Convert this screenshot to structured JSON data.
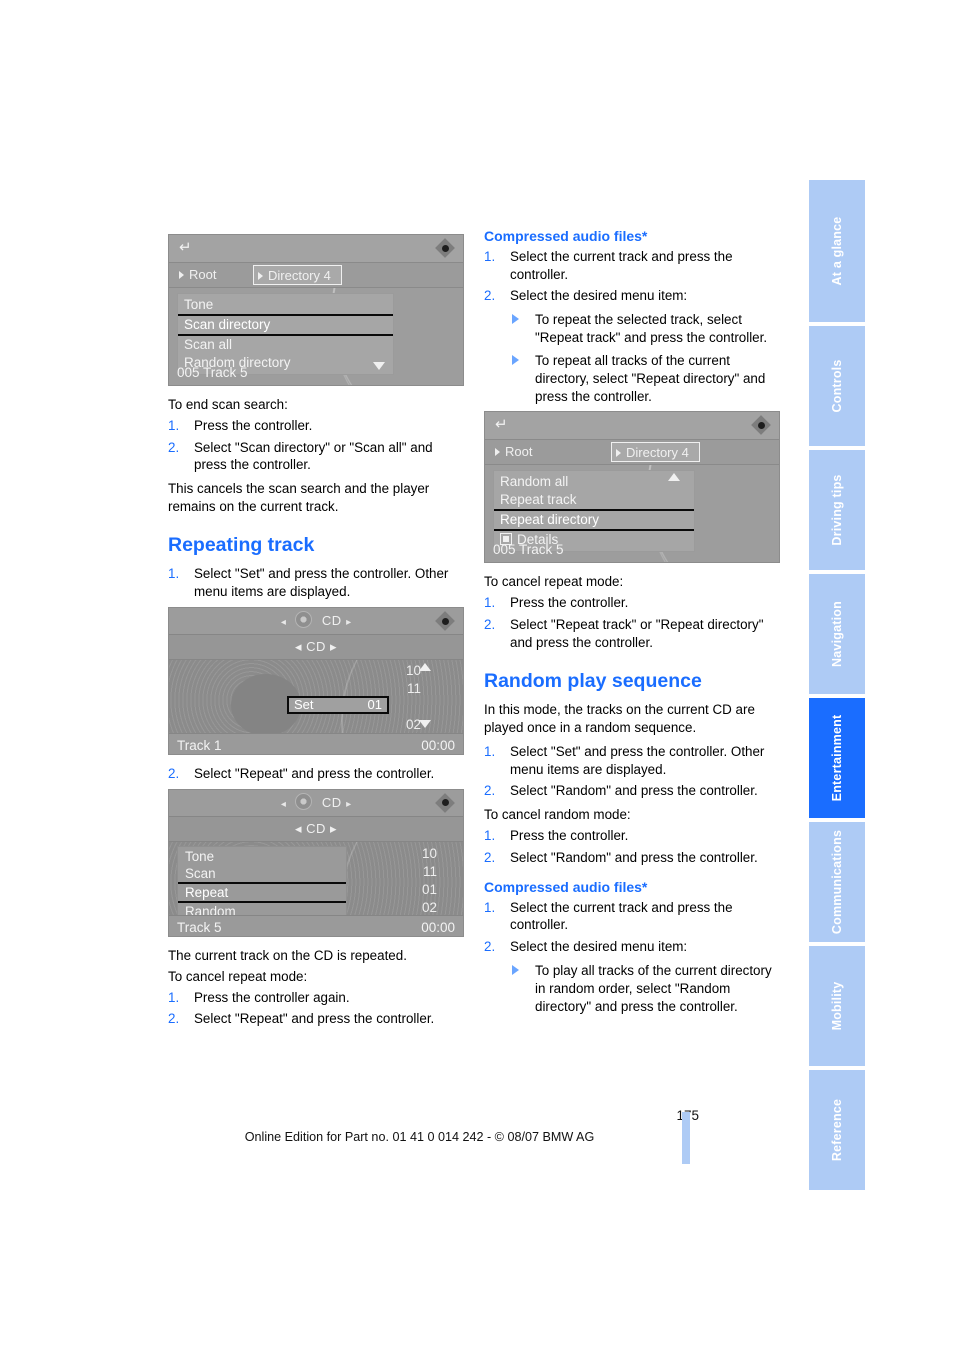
{
  "page": {
    "number": "175",
    "footer_line": "Online Edition for Part no. 01 41 0 014 242 - © 08/07 BMW AG",
    "accent_blue": "#1a6dff",
    "tab_blue_inactive": "#aecbf5"
  },
  "sidebar": {
    "tabs": [
      {
        "label": "At a glance",
        "active": false
      },
      {
        "label": "Controls",
        "active": false
      },
      {
        "label": "Driving tips",
        "active": false
      },
      {
        "label": "Navigation",
        "active": false
      },
      {
        "label": "Entertainment",
        "active": true
      },
      {
        "label": "Communications",
        "active": false
      },
      {
        "label": "Mobility",
        "active": false
      },
      {
        "label": "Reference",
        "active": false
      }
    ]
  },
  "left_column": {
    "shot_scan": {
      "back_icon": "back-arrow-icon",
      "diamond_icon": "joystick-diamond-icon",
      "crumb_root": "Root",
      "crumb_dir": "Directory 4",
      "menu_items": [
        "Tone",
        "Scan directory",
        "Scan all",
        "Random directory"
      ],
      "selected_item": "Scan directory",
      "scroll_arrow": "down",
      "status": "005 Track 5"
    },
    "end_scan_title": "To end scan search:",
    "end_scan_steps": [
      "Press the controller.",
      "Select \"Scan directory\" or \"Scan all\" and press the controller."
    ],
    "end_scan_note": "This cancels the scan search and the player remains on the current track.",
    "repeating_track_heading": "Repeating track",
    "repeating_track_steps": [
      "Select \"Set\" and press the controller. Other menu items are displayed."
    ],
    "shot_cd_set": {
      "source": "CD",
      "second_source": "CD",
      "disc_icon": "cd-disc-icon",
      "diamond_icon": "joystick-diamond-icon",
      "track_numbers": [
        "10",
        "11",
        "02"
      ],
      "set_label": "Set",
      "set_value": "01",
      "scroll_up": "up",
      "scroll_down": "down",
      "track_label": "Track 1",
      "time": "00:00"
    },
    "repeat_step2": "Select \"Repeat\" and press the controller.",
    "shot_cd_menu": {
      "source": "CD",
      "second_source": "CD",
      "disc_icon": "cd-disc-icon",
      "diamond_icon": "joystick-diamond-icon",
      "menu_items": [
        "Tone",
        "Scan",
        "Repeat",
        "Random"
      ],
      "selected_item": "Repeat",
      "track_numbers": [
        "10",
        "11",
        "01",
        "02"
      ],
      "track_label": "Track 5",
      "time": "00:00"
    },
    "repeated_note": "The current track on the CD is repeated.",
    "cancel_repeat_title": "To cancel repeat mode:",
    "cancel_repeat_steps": [
      "Press the controller again.",
      "Select \"Repeat\" and press the controller."
    ]
  },
  "right_column": {
    "compressed_heading_1": "Compressed audio files*",
    "compressed_steps_1": [
      "Select the current track and press the controller.",
      "Select the desired menu item:"
    ],
    "compressed_bullets_1": [
      "To repeat the selected track, select \"Repeat track\" and press the controller.",
      "To repeat all tracks of the current directory, select \"Repeat directory\" and press the controller."
    ],
    "shot_repeat_dir": {
      "back_icon": "back-arrow-icon",
      "diamond_icon": "joystick-diamond-icon",
      "crumb_root": "Root",
      "crumb_dir": "Directory 4",
      "menu_items": [
        "Random all",
        "Repeat track",
        "Repeat directory",
        "Details"
      ],
      "selected_item": "Repeat directory",
      "details_checkbox": "checkbox-icon",
      "scroll_arrow": "up",
      "status": "005 Track 5"
    },
    "cancel_repeat_title": "To cancel repeat mode:",
    "cancel_repeat_steps": [
      "Press the controller.",
      "Select \"Repeat track\" or \"Repeat directory\" and press the controller."
    ],
    "random_heading": "Random play sequence",
    "random_intro": "In this mode, the tracks on the current CD are played once in a random sequence.",
    "random_steps": [
      "Select \"Set\" and press the controller. Other menu items are displayed.",
      "Select \"Random\" and press the controller."
    ],
    "cancel_random_title": "To cancel random mode:",
    "cancel_random_steps": [
      "Press the controller.",
      "Select \"Random\" and press the controller."
    ],
    "compressed_heading_2": "Compressed audio files*",
    "compressed_steps_2": [
      "Select the current track and press the controller.",
      "Select the desired menu item:"
    ],
    "compressed_bullets_2": [
      "To play all tracks of the current directory in random order, select \"Random directory\" and press the controller."
    ]
  }
}
